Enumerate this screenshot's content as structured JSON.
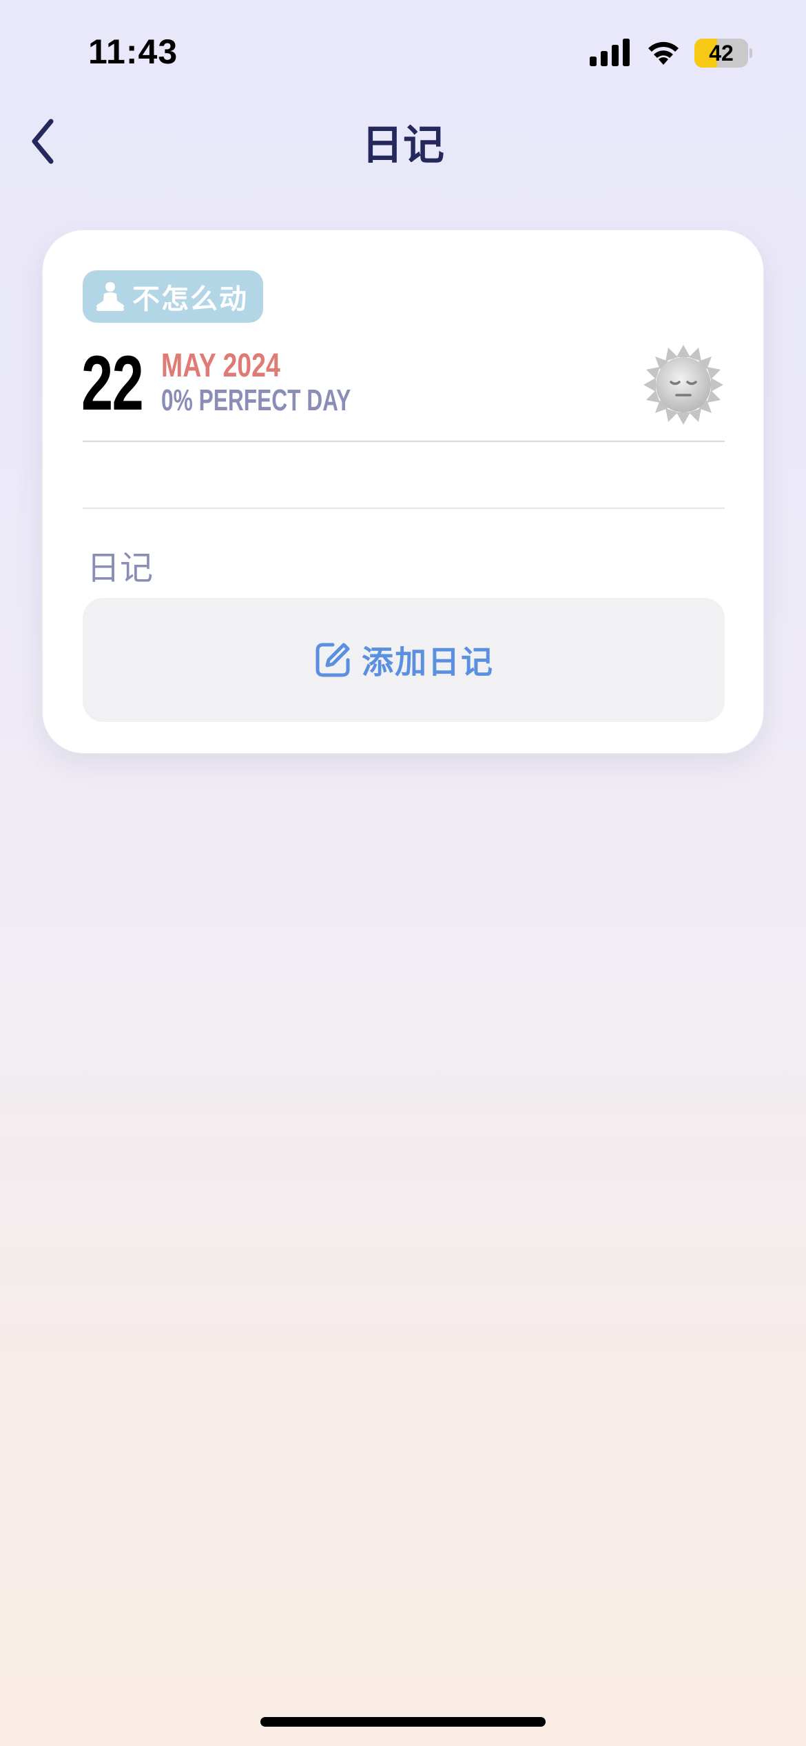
{
  "status_bar": {
    "time": "11:43",
    "battery_level": 42,
    "battery_text": "42",
    "battery_color": "#f7c814",
    "icons": [
      "signal-icon",
      "wifi-icon",
      "battery-icon"
    ]
  },
  "nav": {
    "title": "日记",
    "back_icon": "chevron-left-icon"
  },
  "entry": {
    "activity_badge": {
      "icon": "meditation-person-icon",
      "label": "不怎么动",
      "color": "#b3d6e6"
    },
    "day": "22",
    "month_year": "MAY 2024",
    "perfect_day": "0% PERFECT DAY",
    "mood_icon": "sleepy-sun-icon",
    "diary_section_label": "日记",
    "add_diary_label": "添加日记",
    "add_diary_icon": "edit-square-icon"
  },
  "colors": {
    "accent_blue": "#5b8fe0",
    "month_red": "#e07a74",
    "muted_purple": "#8a8db5",
    "title_navy": "#24285a"
  }
}
